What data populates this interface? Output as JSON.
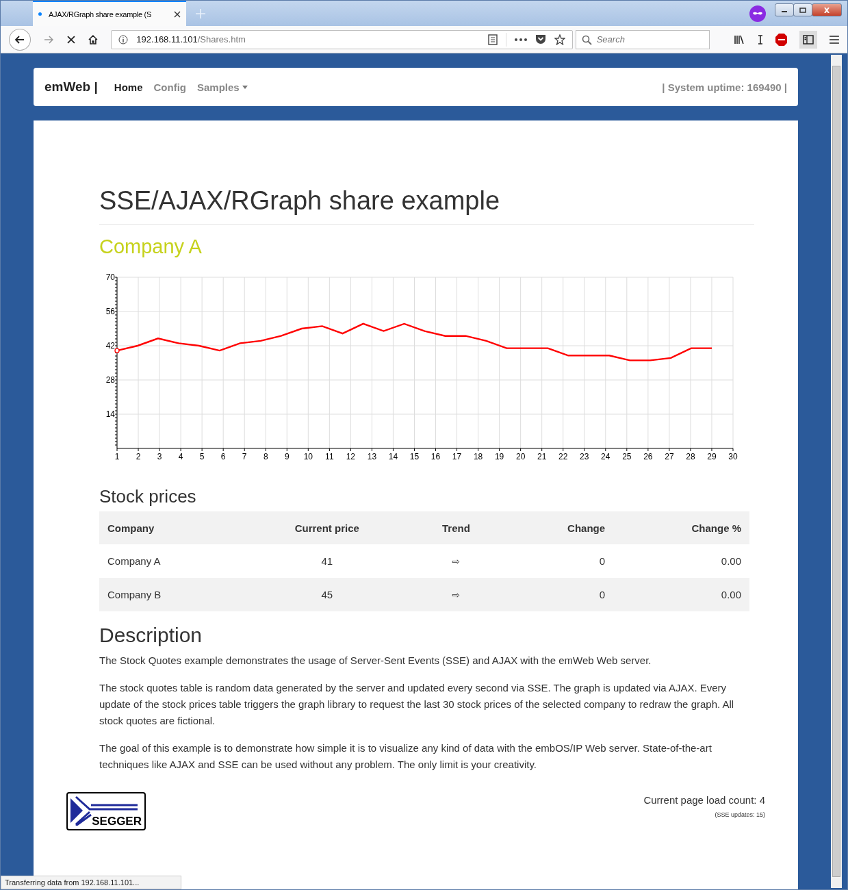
{
  "browser": {
    "tab_title": "AJAX/RGraph share example (S",
    "url_host": "192.168.11.101",
    "url_path": "/Shares.htm",
    "search_placeholder": "Search",
    "status_text": "Transferring data from 192.168.11.101..."
  },
  "navbar": {
    "brand": "emWeb |",
    "links": [
      {
        "label": "Home",
        "selected": true,
        "dropdown": false
      },
      {
        "label": "Config",
        "selected": false,
        "dropdown": false
      },
      {
        "label": "Samples",
        "selected": false,
        "dropdown": true
      }
    ],
    "uptime": "| System uptime: 169490 |"
  },
  "page": {
    "title": "SSE/AJAX/RGraph share example",
    "company": "Company A",
    "chart_data": {
      "type": "line",
      "grid": true,
      "x": [
        1,
        1.97,
        2.93,
        3.9,
        4.86,
        5.83,
        6.79,
        7.76,
        8.72,
        9.69,
        10.66,
        11.62,
        12.59,
        13.55,
        14.52,
        15.48,
        16.45,
        17.41,
        18.38,
        19.34,
        20.31,
        21.28,
        22.24,
        23.21,
        24.17,
        25.14,
        26.1,
        27.07,
        28.03,
        29
      ],
      "series": [
        {
          "color": "#ff0000",
          "values": [
            40,
            42,
            45,
            43,
            42,
            40,
            43,
            44,
            46,
            49,
            50,
            47,
            51,
            48,
            51,
            48,
            46,
            46,
            44,
            41,
            41,
            41,
            38,
            38,
            38,
            36,
            36,
            37,
            41,
            41
          ]
        }
      ],
      "xlim": [
        1,
        30
      ],
      "xticks": [
        1,
        2,
        3,
        4,
        5,
        6,
        7,
        8,
        9,
        10,
        11,
        12,
        13,
        14,
        15,
        16,
        17,
        18,
        19,
        20,
        21,
        22,
        23,
        24,
        25,
        26,
        27,
        28,
        29,
        30
      ],
      "ylim": [
        0,
        70
      ],
      "yticks": [
        14,
        28,
        42,
        56,
        70
      ]
    },
    "stock_heading": "Stock prices",
    "table": {
      "columns": [
        "Company",
        "Current price",
        "Trend",
        "Change",
        "Change %"
      ],
      "rows": [
        {
          "company": "Company A",
          "price": "41",
          "trend": "⇨",
          "change": "0",
          "change_pct": "0.00"
        },
        {
          "company": "Company B",
          "price": "45",
          "trend": "⇨",
          "change": "0",
          "change_pct": "0.00"
        }
      ]
    },
    "description_heading": "Description",
    "paragraphs": [
      "The Stock Quotes example demonstrates the usage of Server-Sent Events (SSE) and AJAX with the emWeb Web server.",
      "The stock quotes table is random data generated by the server and updated every second via SSE. The graph is updated via AJAX. Every update of the stock prices table triggers the graph library to request the last 30 stock prices of the selected company to redraw the graph. All stock quotes are fictional.",
      "The goal of this example is to demonstrate how simple it is to visualize any kind of data with the embOS/IP Web server. State-of-the-art techniques like AJAX and SSE can be used without any problem. The only limit is your creativity."
    ],
    "logo_text": "SEGGER",
    "load_count": "Current page load count: 4",
    "sse_updates": "(SSE updates: 15)"
  }
}
